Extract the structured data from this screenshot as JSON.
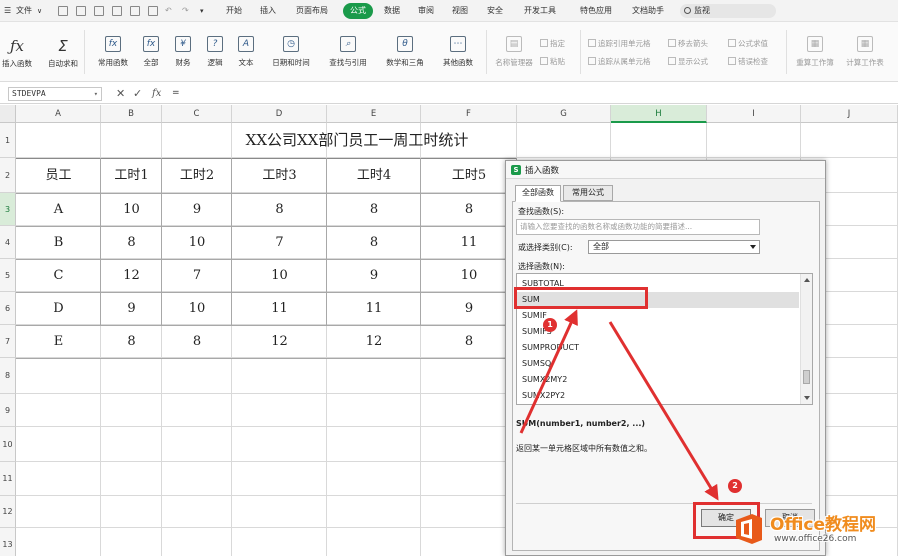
{
  "menubar": {
    "file_label": "文件",
    "items": [
      "开始",
      "插入",
      "页面布局",
      "公式",
      "数据",
      "审阅",
      "视图",
      "安全",
      "开发工具",
      "特色应用",
      "文档助手"
    ],
    "active_item": "公式",
    "search_label": "监视"
  },
  "ribbon": {
    "insert_function": "插入函数",
    "autosum": "自动求和",
    "buttons": [
      "常用函数",
      "全部",
      "财务",
      "逻辑",
      "文本",
      "日期和时间",
      "查找与引用",
      "数学和三角",
      "其他函数"
    ],
    "name_manager": "名称管理器",
    "define_name": "指定",
    "paste": "粘贴",
    "trace_precedents": "追踪引用单元格",
    "trace_dependents": "追踪从属单元格",
    "remove_arrows": "移去箭头",
    "show_formulas": "显示公式",
    "evaluate_formula": "公式求值",
    "error_check": "错误检查",
    "recalc_workbook": "重算工作簿",
    "calc_sheet": "计算工作表"
  },
  "formula_bar": {
    "name_box": "STDEVPA",
    "cancel_icon": "✕",
    "confirm_icon": "✓",
    "fx_label": "fx",
    "formula": "="
  },
  "grid": {
    "columns": [
      "A",
      "B",
      "C",
      "D",
      "E",
      "F",
      "G",
      "H",
      "I",
      "J"
    ],
    "rows": [
      "1",
      "2",
      "3",
      "4",
      "5",
      "6",
      "7",
      "8",
      "9",
      "10",
      "11",
      "12",
      "13"
    ],
    "title": "XX公司XX部门员工一周工时统计",
    "headers": [
      "员工",
      "工时1",
      "工时2",
      "工时3",
      "工时4",
      "工时5"
    ],
    "data": [
      [
        "A",
        "10",
        "9",
        "8",
        "8",
        "8"
      ],
      [
        "B",
        "8",
        "10",
        "7",
        "8",
        "11"
      ],
      [
        "C",
        "12",
        "7",
        "10",
        "9",
        "10"
      ],
      [
        "D",
        "9",
        "10",
        "11",
        "11",
        "9"
      ],
      [
        "E",
        "8",
        "8",
        "12",
        "12",
        "8"
      ]
    ]
  },
  "dialog": {
    "title": "插入函数",
    "tabs": [
      "全部函数",
      "常用公式"
    ],
    "search_label": "查找函数(S):",
    "search_placeholder": "请输入您要查找的函数名称或函数功能的简要描述...",
    "category_label": "或选择类别(C):",
    "category_value": "全部",
    "select_label": "选择函数(N):",
    "functions": [
      "SUBTOTAL",
      "SUM",
      "SUMIF",
      "SUMIFS",
      "SUMPRODUCT",
      "SUMSQ",
      "SUMX2MY2",
      "SUMX2PY2"
    ],
    "selected_function": "SUM",
    "signature": "SUM(number1, number2, ...)",
    "description": "返回某一单元格区域中所有数值之和。",
    "ok_label": "确定",
    "cancel_label": "取消"
  },
  "annotations": {
    "marker1": "1",
    "marker2": "2",
    "color": "#e03030"
  },
  "watermark": {
    "name": "Office教程网",
    "url": "www.office26.com"
  },
  "colors": {
    "accent_green": "#1a9a4a",
    "highlight_red": "#e03030",
    "watermark_orange": "#f08c1e"
  }
}
